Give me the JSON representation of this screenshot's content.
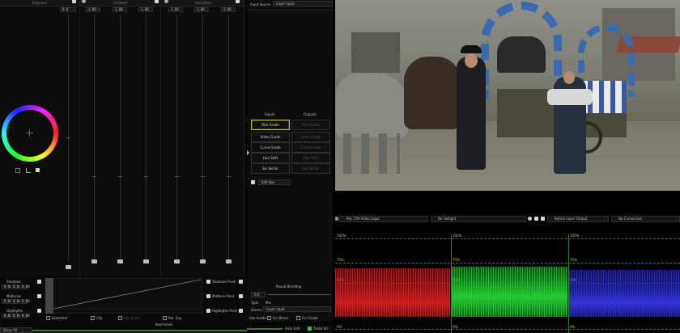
{
  "colors": {
    "accent_yellow": "#b8b85a",
    "scope_red": "#e02020",
    "scope_green": "#20d030",
    "scope_blue": "#3030e0",
    "guide_green": "#3a7a2a",
    "status_green": "#3fbf2f"
  },
  "primaries": {
    "headers": [
      "Exposure",
      "Contrast",
      "Saturation"
    ],
    "exposure_value": "0.0",
    "contrast_values": [
      "1.00",
      "1.00",
      "1.00"
    ],
    "saturation_values": [
      "1.00",
      "1.00",
      "1.00"
    ],
    "wheel_icons": [
      "picker-icon",
      "curve-icon",
      "square-icon"
    ]
  },
  "secondary": {
    "rows": [
      {
        "label": "Shadows",
        "values": [
          "0.00",
          "0.00",
          "0.00"
        ]
      },
      {
        "label": "Midtones",
        "values": [
          "0.00",
          "0.00",
          "0.00"
        ]
      },
      {
        "label": "Highlights",
        "values": [
          "0.00",
          "0.00",
          "0.00"
        ]
      }
    ],
    "right_rows": [
      "Shadows Pivot",
      "Midtone Pivot",
      "Highlights Pivot"
    ],
    "checkboxes": [
      "Extended",
      "Clip",
      "Use Knots",
      "Rel. Exp."
    ],
    "footer": "Keyframes",
    "show_all": "Show All"
  },
  "operators": {
    "input_source_label": "Input Source",
    "input_source_value": "Layer Input",
    "col_inputs": "Inputs",
    "col_outputs": "Outputs",
    "inputs": [
      "Film Grade",
      "Video Grade",
      "Curve Grade",
      "Hue Shift",
      "Six Vector"
    ],
    "outputs": [
      "Film Grade",
      "Video Grade",
      "Curve Grade",
      "Hue Shift",
      "Six Vector"
    ],
    "edit_box": "Edit Box",
    "result_blending": "Result Blending",
    "blend_value": "0.0",
    "type_label": "Type",
    "type_value": "Mix",
    "source_label": "Source",
    "source_value": "Layer Input",
    "use_inside": "Use Inside",
    "for_blend": "For Blend",
    "for_grade": "For Grade",
    "auto_edit": "Auto Edit",
    "status": "Tmbd",
    "status_suffix": "KFr"
  },
  "scope": {
    "toolbar": [
      "Rec.709 Video Legal",
      "No Toelight",
      "Before Layer Output",
      "No Conversion"
    ],
    "levels": [
      "100%",
      "75%",
      "50%",
      "25%",
      "0%"
    ]
  }
}
